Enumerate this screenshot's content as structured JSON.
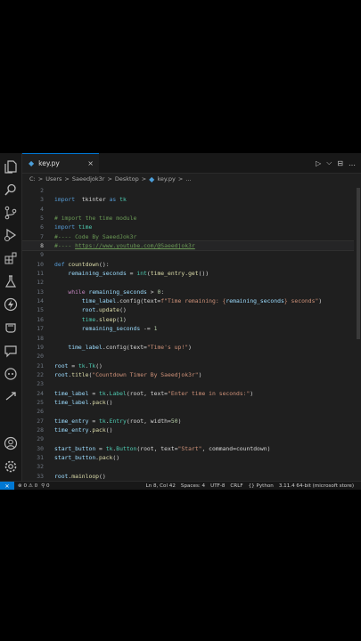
{
  "tab": {
    "icon": "python-file-icon",
    "title": "key.py",
    "close": "×"
  },
  "actions": {
    "run": "▷",
    "dropdown": "⌵",
    "split": "⊟",
    "more": "…"
  },
  "breadcrumbs": [
    "C:",
    "Users",
    "Saeedjok3r",
    "Desktop",
    "key.py",
    "…"
  ],
  "breadcrumb_sep": ">",
  "activity_icons": [
    "explorer-icon",
    "search-icon",
    "source-control-icon",
    "run-debug-icon",
    "extensions-icon",
    "testing-icon",
    "thunder-client-icon",
    "flask-icon",
    "chat-icon",
    "github-copilot-icon",
    "live-share-icon",
    "account-icon",
    "settings-gear-icon"
  ],
  "code": [
    {
      "n": "2",
      "t": []
    },
    {
      "n": "3",
      "t": [
        [
          "kw",
          "import"
        ],
        [
          "",
          "  tkinter "
        ],
        [
          "kw",
          "as"
        ],
        [
          "cls",
          " tk"
        ]
      ]
    },
    {
      "n": "4",
      "t": []
    },
    {
      "n": "5",
      "t": [
        [
          "cm",
          "# import the time module"
        ]
      ]
    },
    {
      "n": "6",
      "t": [
        [
          "kw",
          "import"
        ],
        [
          "cls",
          " time"
        ]
      ]
    },
    {
      "n": "7",
      "t": [
        [
          "cm",
          "#---- Code By SaeedJok3r"
        ]
      ]
    },
    {
      "n": "8",
      "t": [
        [
          "cm",
          "#---- "
        ],
        [
          "url",
          "https://www.youtube.com/@Saeedjok3r"
        ]
      ],
      "active": true
    },
    {
      "n": "9",
      "t": []
    },
    {
      "n": "10",
      "t": [
        [
          "kw",
          "def"
        ],
        [
          "fn",
          " countdown"
        ],
        [
          "",
          "():"
        ]
      ]
    },
    {
      "n": "11",
      "t": [
        [
          "var",
          "    remaining_seconds"
        ],
        [
          "",
          " = "
        ],
        [
          "cls",
          "int"
        ],
        [
          "",
          "("
        ],
        [
          "fn",
          "time_entry.get"
        ],
        [
          "",
          "())"
        ]
      ]
    },
    {
      "n": "12",
      "t": []
    },
    {
      "n": "13",
      "t": [
        [
          "ctl",
          "    while"
        ],
        [
          "var",
          " remaining_seconds"
        ],
        [
          "",
          " > "
        ],
        [
          "num",
          "0"
        ],
        [
          "",
          ":"
        ]
      ]
    },
    {
      "n": "14",
      "t": [
        [
          "var",
          "        time_label"
        ],
        [
          "",
          ".config(text="
        ],
        [
          "str",
          "f\"Time remaining: {"
        ],
        [
          "var",
          "remaining_seconds"
        ],
        [
          "str",
          "} seconds\""
        ],
        [
          "",
          ")"
        ]
      ]
    },
    {
      "n": "15",
      "t": [
        [
          "var",
          "        root"
        ],
        [
          "",
          "."
        ],
        [
          "fn",
          "update"
        ],
        [
          "",
          "()"
        ]
      ]
    },
    {
      "n": "16",
      "t": [
        [
          "cls",
          "        time"
        ],
        [
          "",
          "."
        ],
        [
          "fn",
          "sleep"
        ],
        [
          "",
          "("
        ],
        [
          "num",
          "1"
        ],
        [
          "",
          ")"
        ]
      ]
    },
    {
      "n": "17",
      "t": [
        [
          "var",
          "        remaining_seconds"
        ],
        [
          "",
          " -= "
        ],
        [
          "num",
          "1"
        ]
      ]
    },
    {
      "n": "18",
      "t": []
    },
    {
      "n": "19",
      "t": [
        [
          "var",
          "    time_label"
        ],
        [
          "",
          ".config(text="
        ],
        [
          "str",
          "\"Time's up!\""
        ],
        [
          "",
          ")"
        ]
      ]
    },
    {
      "n": "20",
      "t": []
    },
    {
      "n": "21",
      "t": [
        [
          "var",
          "root"
        ],
        [
          "",
          " = "
        ],
        [
          "cls",
          "tk"
        ],
        [
          "",
          "."
        ],
        [
          "cls",
          "Tk"
        ],
        [
          "",
          "()"
        ]
      ]
    },
    {
      "n": "22",
      "t": [
        [
          "var",
          "root"
        ],
        [
          "",
          "."
        ],
        [
          "fn",
          "title"
        ],
        [
          "",
          "("
        ],
        [
          "str",
          "\"Countdown Timer By Saeedjok3r\""
        ],
        [
          "",
          ")"
        ]
      ]
    },
    {
      "n": "23",
      "t": []
    },
    {
      "n": "24",
      "t": [
        [
          "var",
          "time_label"
        ],
        [
          "",
          " = "
        ],
        [
          "cls",
          "tk"
        ],
        [
          "",
          "."
        ],
        [
          "cls",
          "Label"
        ],
        [
          "",
          "(root, text="
        ],
        [
          "str",
          "\"Enter time in seconds:\""
        ],
        [
          "",
          ")"
        ]
      ]
    },
    {
      "n": "25",
      "t": [
        [
          "var",
          "time_label"
        ],
        [
          "",
          "."
        ],
        [
          "fn",
          "pack"
        ],
        [
          "",
          "()"
        ]
      ]
    },
    {
      "n": "26",
      "t": []
    },
    {
      "n": "27",
      "t": [
        [
          "var",
          "time_entry"
        ],
        [
          "",
          " = "
        ],
        [
          "cls",
          "tk"
        ],
        [
          "",
          "."
        ],
        [
          "cls",
          "Entry"
        ],
        [
          "",
          "(root, width="
        ],
        [
          "num",
          "50"
        ],
        [
          "",
          ")"
        ]
      ]
    },
    {
      "n": "28",
      "t": [
        [
          "var",
          "time_entry"
        ],
        [
          "",
          "."
        ],
        [
          "fn",
          "pack"
        ],
        [
          "",
          "()"
        ]
      ]
    },
    {
      "n": "29",
      "t": []
    },
    {
      "n": "30",
      "t": [
        [
          "var",
          "start_button"
        ],
        [
          "",
          " = "
        ],
        [
          "cls",
          "tk"
        ],
        [
          "",
          "."
        ],
        [
          "cls",
          "Button"
        ],
        [
          "",
          "(root, text="
        ],
        [
          "str",
          "\"Start\""
        ],
        [
          "",
          ", command=countdown)"
        ]
      ]
    },
    {
      "n": "31",
      "t": [
        [
          "var",
          "start_button"
        ],
        [
          "",
          "."
        ],
        [
          "fn",
          "pack"
        ],
        [
          "",
          "()"
        ]
      ]
    },
    {
      "n": "32",
      "t": []
    },
    {
      "n": "33",
      "t": [
        [
          "var",
          "root"
        ],
        [
          "",
          "."
        ],
        [
          "fn",
          "mainloop"
        ],
        [
          "",
          "()"
        ]
      ]
    }
  ],
  "status": {
    "remote": "✕",
    "problems": "⊗ 0 ⚠ 0",
    "ports": "⚲ 0",
    "cursor": "Ln 8, Col 42",
    "spaces": "Spaces: 4",
    "encoding": "UTF-8",
    "eol": "CRLF",
    "language": "{} Python",
    "interpreter": "3.11.4 64-bit (microsoft store)"
  }
}
